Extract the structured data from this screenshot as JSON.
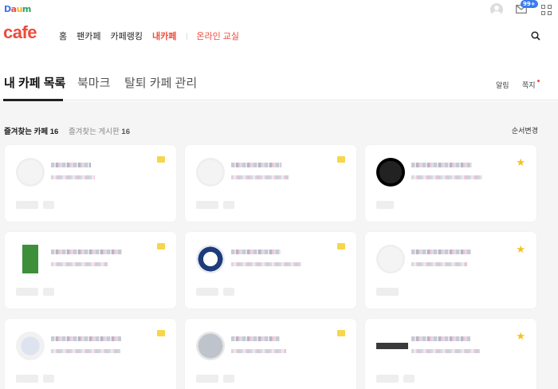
{
  "top": {
    "daum_logo": "Daum",
    "mail_badge": "99+"
  },
  "nav": {
    "cafe_logo": "cafe",
    "items": [
      "홈",
      "팬카페",
      "카페랭킹",
      "내카페"
    ],
    "online": "온라인 교실"
  },
  "tabs": {
    "items": [
      "내 카페 목록",
      "북마크",
      "탈퇴 카페 관리"
    ],
    "alarm": "알림",
    "note": "쪽지"
  },
  "list": {
    "fav_cafe": "즐겨찾는 카페 16",
    "fav_board_label": "즐겨찾는 게시판",
    "fav_board_count": "16",
    "reorder": "순서변경"
  },
  "cards": [
    {
      "mark": "note-icon"
    },
    {
      "mark": "note-icon"
    },
    {
      "mark": "star-icon"
    },
    {
      "mark": "note-icon"
    },
    {
      "mark": "note-icon"
    },
    {
      "mark": "star-icon"
    },
    {
      "mark": "note-icon"
    },
    {
      "mark": "note-icon"
    },
    {
      "mark": "star-icon"
    }
  ],
  "colors": {
    "brand": "#f04a3a",
    "star": "#f4c21a",
    "note": "#f6d64a",
    "badge": "#3a7bf0"
  }
}
